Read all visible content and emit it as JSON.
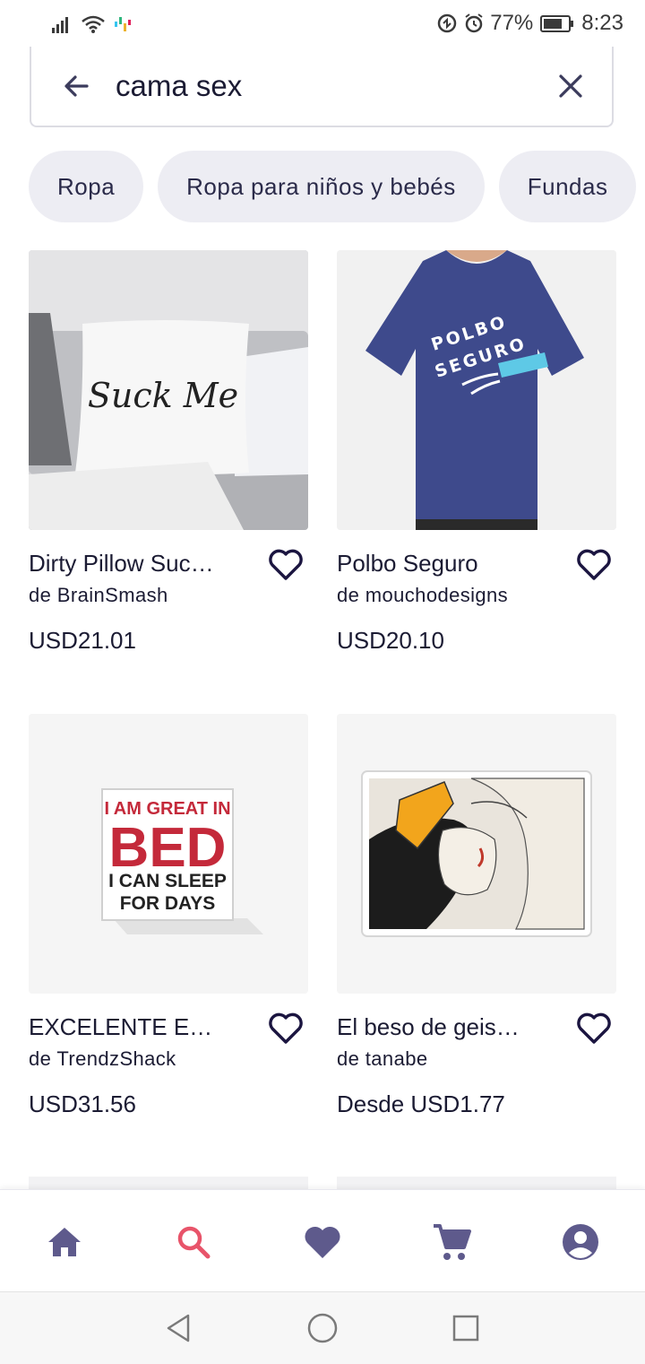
{
  "status_bar": {
    "battery": "77%",
    "time": "8:23"
  },
  "search": {
    "query": "cama sex"
  },
  "chips": [
    "Ropa",
    "Ropa para niños y bebés",
    "Fundas"
  ],
  "products": [
    {
      "title": "Dirty Pillow Suc…",
      "artist": "de BrainSmash",
      "price": "USD21.01",
      "image_text": "Suck Me"
    },
    {
      "title": "Polbo Seguro",
      "artist": "de mouchodesigns",
      "price": "USD20.10",
      "image_text_line1": "POLBO",
      "image_text_line2": "SEGURO"
    },
    {
      "title": "EXCELENTE E…",
      "artist": "de TrendzShack",
      "price": "USD31.56",
      "image_text_line1": "I AM GREAT IN",
      "image_text_line2": "BED",
      "image_text_line3": "I CAN SLEEP",
      "image_text_line4": "FOR DAYS"
    },
    {
      "title": "El beso de geis…",
      "artist": "de tanabe",
      "price": "Desde USD1.77"
    }
  ],
  "bottom_nav": {
    "items": [
      "home-icon",
      "search-icon",
      "heart-icon",
      "cart-icon",
      "account-icon"
    ],
    "active": "search-icon",
    "active_color": "#e8546a",
    "icon_color": "#5e5a8c"
  }
}
